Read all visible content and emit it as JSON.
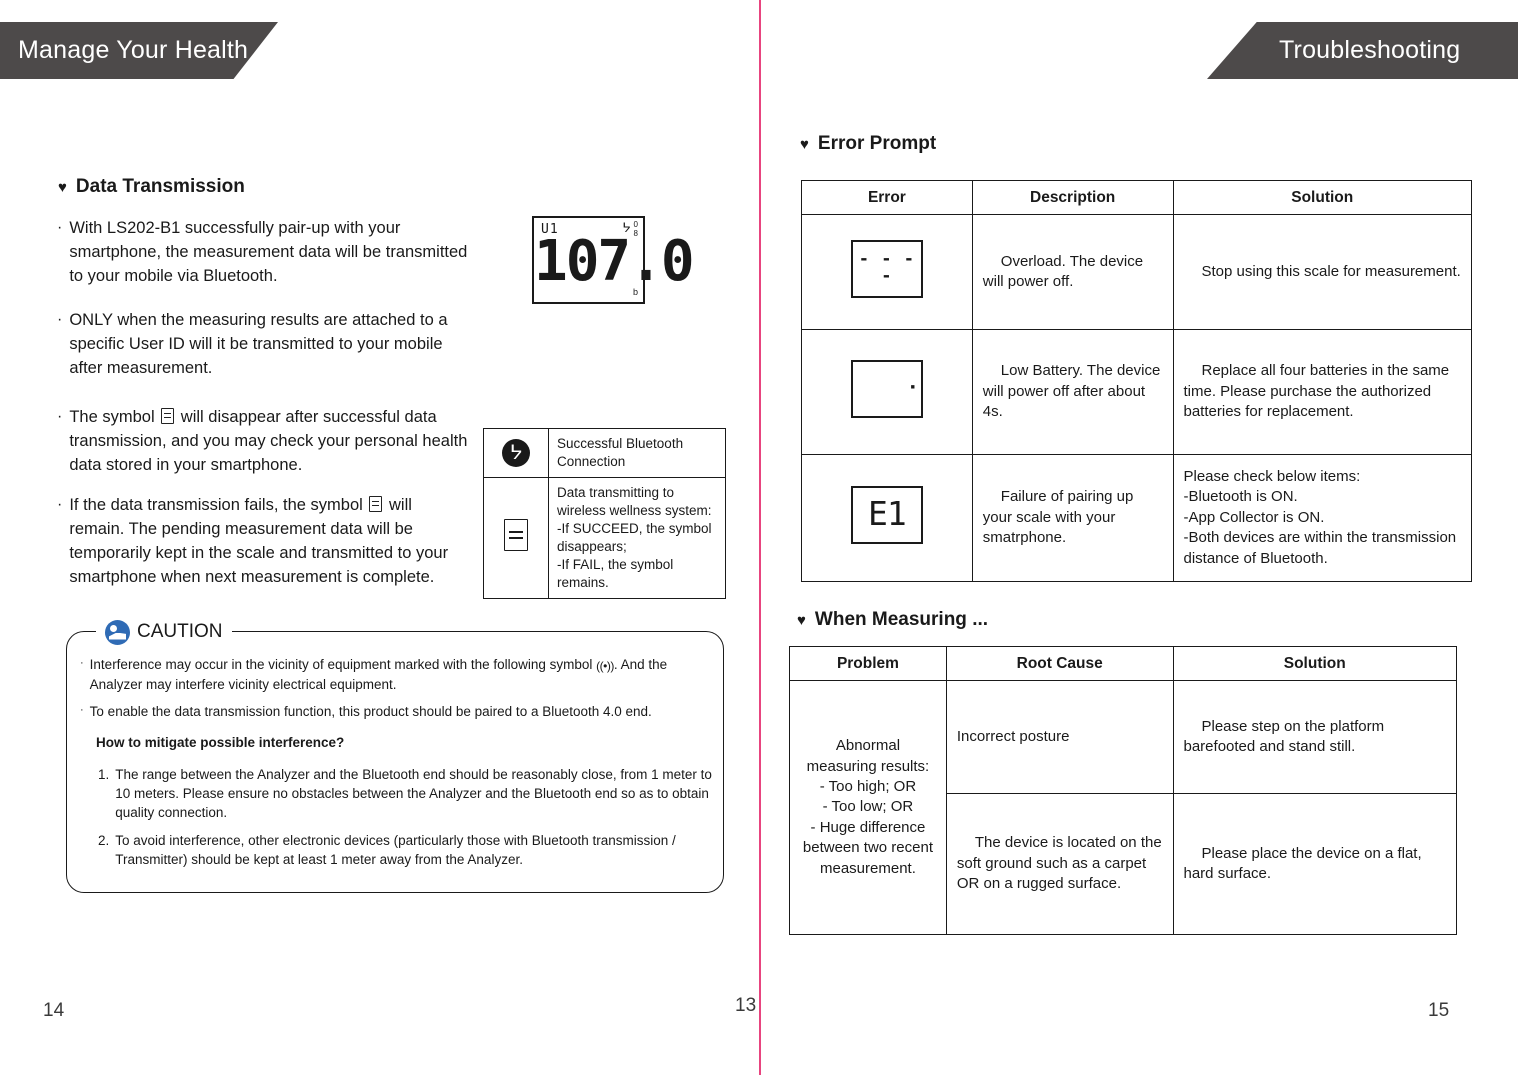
{
  "left_page": {
    "banner_title": "Manage Your Health",
    "page_number": "14",
    "section_heading": "Data Transmission",
    "bullets": [
      "With LS202-B1 successfully pair-up with your smartphone, the measurement data will be transmitted to your mobile via Bluetooth.",
      "ONLY when the measuring results are attached to a specific User ID will it be transmitted to your mobile after measurement."
    ],
    "bullet3_part1": "The symbol",
    "bullet3_part2": "will disappear after successful data transmission, and you may check your personal health data stored in your smartphone.",
    "bullet4_part1": "If the data transmission fails, the symbol",
    "bullet4_part2": "will remain. The pending measurement data will be temporarily kept in the scale and transmitted to your smartphone when next measurement is complete.",
    "lcd": {
      "user_id": "U1",
      "bluetooth_icon": "bluetooth-icon",
      "battery_top": "0",
      "battery_bottom": "8",
      "value": "107.0",
      "unit": "b"
    },
    "symbol_table": [
      {
        "icon": "bluetooth-icon",
        "text": "Successful Bluetooth Connection"
      },
      {
        "icon": "document-icon",
        "text": "Data transmitting to wireless wellness system:\n-If SUCCEED, the symbol disappears;\n-If FAIL, the symbol remains."
      }
    ],
    "caution": {
      "label": "CAUTION",
      "icon": "caution-read-manual-icon",
      "bullet1_part1": "Interference may occur in the vicinity of equipment marked with the following symbol",
      "bullet1_symbol": "((•))",
      "bullet1_part2": ". And the Analyzer may interfere vicinity electrical equipment.",
      "bullet2": "To enable the data transmission function, this product should be paired to a Bluetooth 4.0 end.",
      "question": "How to mitigate possible interference?",
      "items": [
        {
          "num": "1.",
          "text": "The range between the Analyzer and the Bluetooth end should be reasonably close, from 1 meter to 10 meters. Please ensure no obstacles between the Analyzer and the Bluetooth end so as to obtain quality connection."
        },
        {
          "num": "2.",
          "text": "To avoid interference, other electronic devices (particularly those with Bluetooth transmission / Transmitter) should be kept at least 1 meter away from the Analyzer."
        }
      ]
    }
  },
  "center_page_number": "13",
  "right_page": {
    "banner_title": "Troubleshooting",
    "page_number": "15",
    "error_prompt": {
      "heading": "Error Prompt",
      "columns": [
        "Error",
        "Description",
        "Solution"
      ],
      "rows": [
        {
          "icon": "lcd-overload-dashes-icon",
          "icon_value": "- - - -",
          "description": "Overload. The device will power off.",
          "solution": "Stop using this scale for measurement."
        },
        {
          "icon": "lcd-low-battery-icon",
          "icon_value": "",
          "description": "Low Battery. The device will power off after about 4s.",
          "solution": "Replace all four batteries in the same time. Please purchase the authorized batteries for replacement."
        },
        {
          "icon": "lcd-e1-icon",
          "icon_value": "E1",
          "description": "Failure of pairing up your scale with your smatrphone.",
          "solution": "Please check below items:\n-Bluetooth is ON.\n-App Collector is ON.\n-Both devices are within the transmission distance of Bluetooth."
        }
      ]
    },
    "when_measuring": {
      "heading": "When Measuring ...",
      "columns": [
        "Problem",
        "Root Cause",
        "Solution"
      ],
      "problem": "Abnormal measuring results:\n   - Too high; OR\n   - Too low; OR\n   - Huge difference between two recent measurement.",
      "rows": [
        {
          "root_cause": "Incorrect posture",
          "solution": "Please step on the platform barefooted and stand still."
        },
        {
          "root_cause": "The device is located on the soft ground such as a carpet OR on a rugged surface.",
          "solution": "Please place the device on a flat, hard surface."
        }
      ]
    }
  },
  "colors": {
    "banner_bg": "#4d4a4a",
    "divider": "#e8447f",
    "caution_icon": "#2f6bb5",
    "text": "#1a1a1a"
  }
}
